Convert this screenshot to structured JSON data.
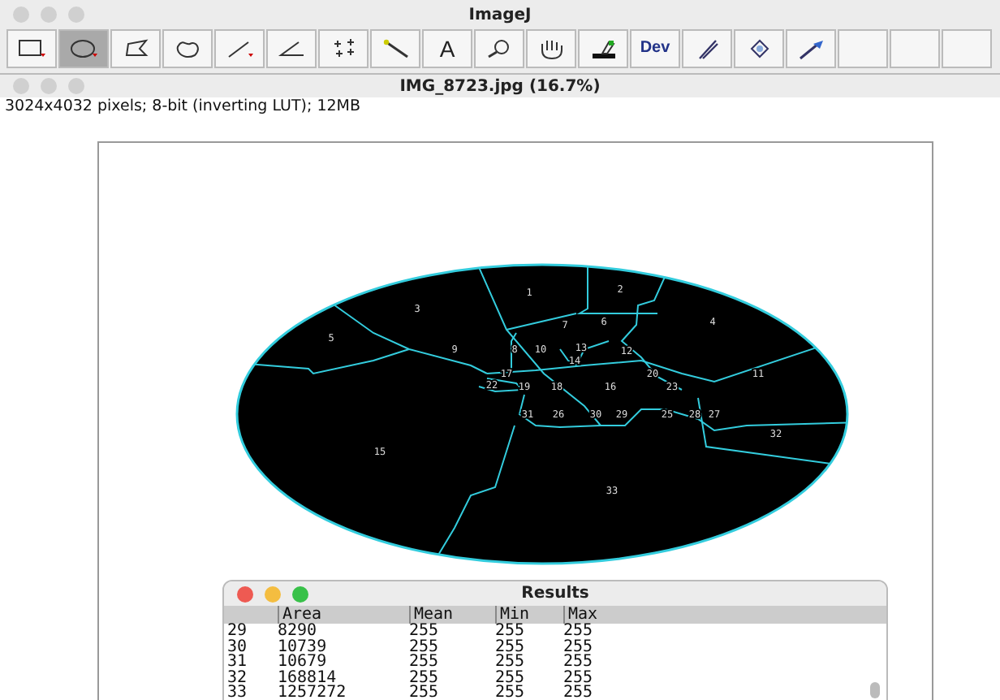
{
  "toolbar_window": {
    "title": "ImageJ",
    "tools": [
      {
        "kind": "rectangle",
        "selected": false
      },
      {
        "kind": "oval",
        "selected": true
      },
      {
        "kind": "polygon",
        "selected": false
      },
      {
        "kind": "freehand",
        "selected": false
      },
      {
        "kind": "line",
        "selected": false
      },
      {
        "kind": "angle",
        "selected": false
      },
      {
        "kind": "multipoint",
        "selected": false
      },
      {
        "kind": "wand",
        "selected": false
      },
      {
        "kind": "text",
        "label": "A",
        "selected": false
      },
      {
        "kind": "magnifier",
        "selected": false
      },
      {
        "kind": "hand",
        "selected": false
      },
      {
        "kind": "dropper",
        "selected": false
      },
      {
        "kind": "dev",
        "label": "Dev",
        "selected": false
      },
      {
        "kind": "brush",
        "selected": false
      },
      {
        "kind": "blob",
        "selected": false
      },
      {
        "kind": "arrow",
        "selected": false
      },
      {
        "kind": "blank",
        "selected": false
      },
      {
        "kind": "blank",
        "selected": false
      },
      {
        "kind": "blank",
        "selected": false
      }
    ]
  },
  "image_window": {
    "title": "IMG_8723.jpg (16.7%)",
    "info": "3024x4032 pixels; 8-bit (inverting LUT); 12MB",
    "region_labels": [
      "1",
      "2",
      "3",
      "7",
      "6",
      "4",
      "5",
      "9",
      "8",
      "10",
      "13",
      "12",
      "14",
      "17",
      "20",
      "11",
      "22",
      "19",
      "18",
      "16",
      "23",
      "31",
      "26",
      "30",
      "29",
      "25",
      "28",
      "27",
      "32",
      "15",
      "33"
    ]
  },
  "results_window": {
    "title": "Results",
    "columns": [
      "",
      "Area",
      "Mean",
      "Min",
      "Max"
    ],
    "rows": [
      [
        "29",
        "8290",
        "255",
        "255",
        "255"
      ],
      [
        "30",
        "10739",
        "255",
        "255",
        "255"
      ],
      [
        "31",
        "10679",
        "255",
        "255",
        "255"
      ],
      [
        "32",
        "168814",
        "255",
        "255",
        "255"
      ],
      [
        "33",
        "1257272",
        "255",
        "255",
        "255"
      ]
    ]
  }
}
